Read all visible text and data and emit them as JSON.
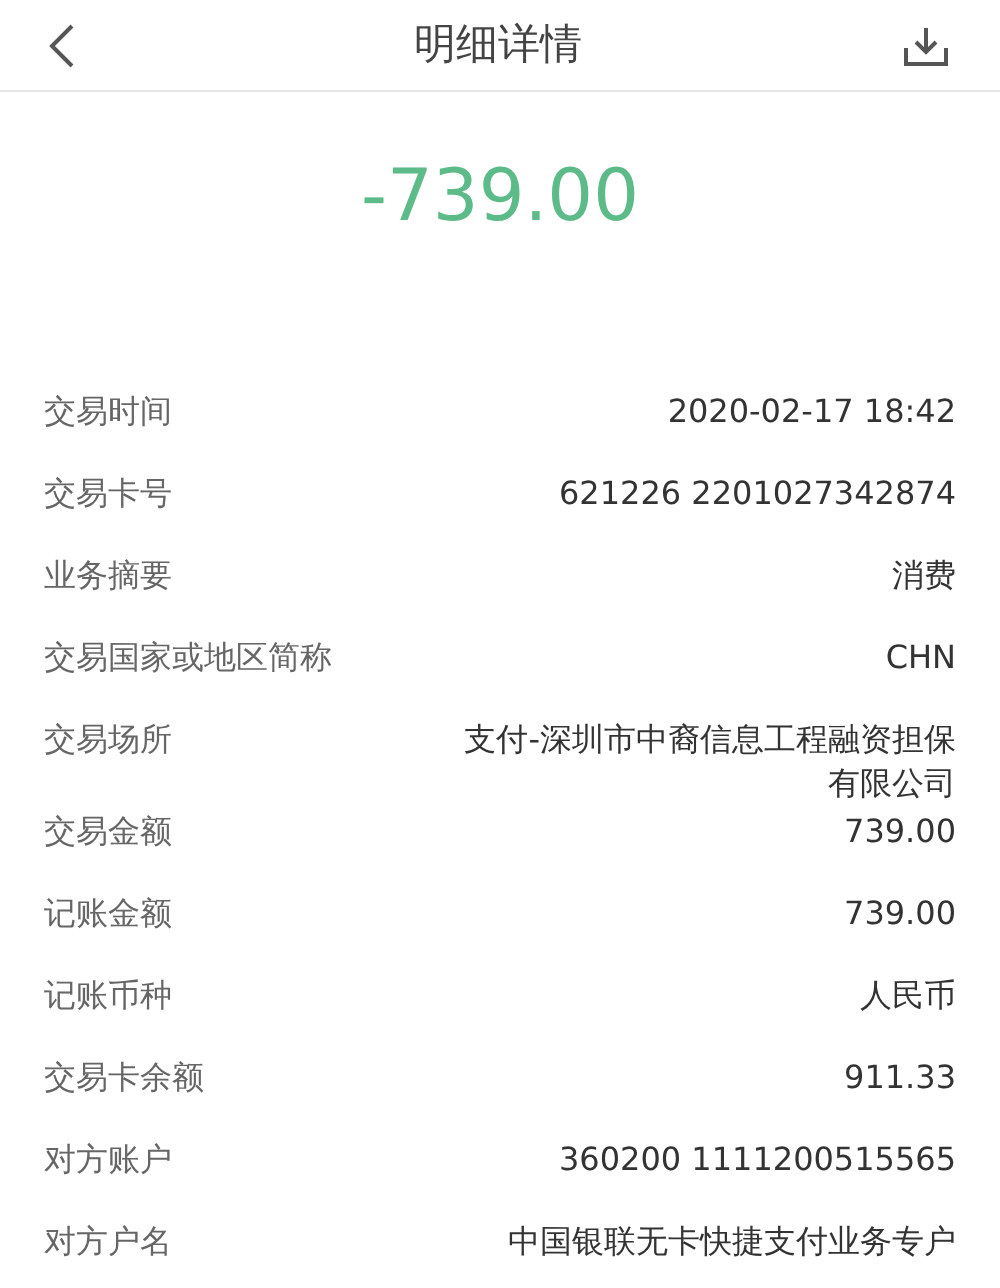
{
  "header": {
    "title": "明细详情"
  },
  "amount": "-739.00",
  "rows": [
    {
      "label": "交易时间",
      "value": "2020-02-17 18:42"
    },
    {
      "label": "交易卡号",
      "value": "621226 2201027342874"
    },
    {
      "label": "业务摘要",
      "value": "消费"
    },
    {
      "label": "交易国家或地区简称",
      "value": "CHN"
    },
    {
      "label": "交易场所",
      "value": "支付-深圳市中裔信息工程融资担保有限公司"
    },
    {
      "label": "交易金额",
      "value": "739.00"
    },
    {
      "label": "记账金额",
      "value": "739.00"
    },
    {
      "label": "记账币种",
      "value": "人民币"
    },
    {
      "label": "交易卡余额",
      "value": "911.33"
    },
    {
      "label": "对方账户",
      "value": "360200 1111200515565"
    },
    {
      "label": "对方户名",
      "value": "中国银联无卡快捷支付业务专户"
    }
  ]
}
